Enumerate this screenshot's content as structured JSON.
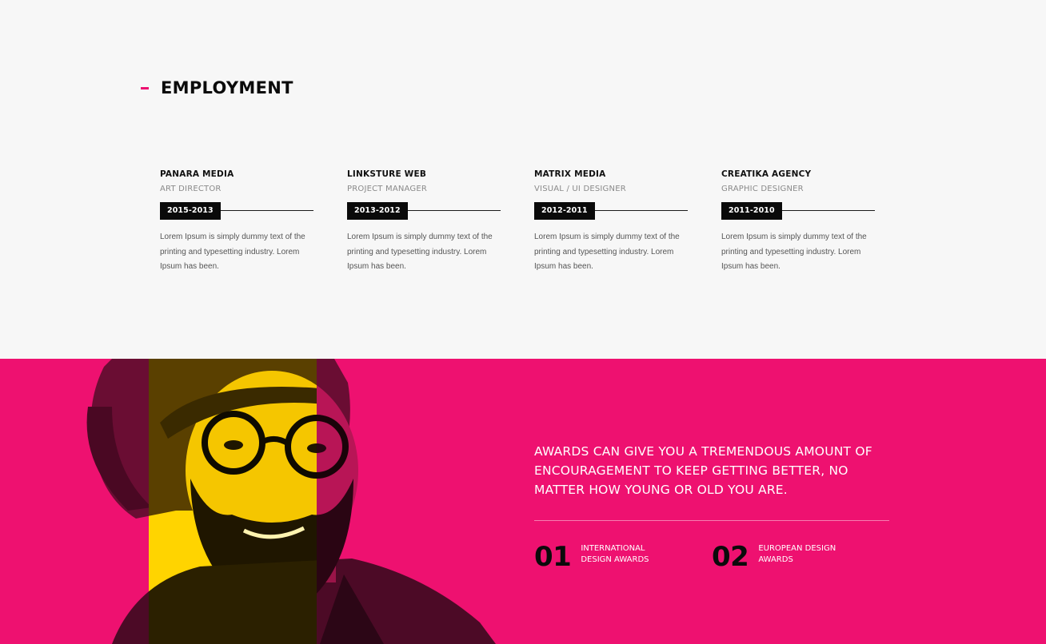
{
  "employment": {
    "title": "EMPLOYMENT",
    "jobs": [
      {
        "company": "PANARA MEDIA",
        "role": "ART DIRECTOR",
        "period": "2015-2013",
        "description": "Lorem Ipsum is simply dummy text of the printing and typesetting industry. Lorem Ipsum has been."
      },
      {
        "company": "LINKSTURE WEB",
        "role": "PROJECT MANAGER",
        "period": "2013-2012",
        "description": "Lorem Ipsum is simply dummy text of the printing and typesetting industry. Lorem Ipsum has been."
      },
      {
        "company": "MATRIX MEDIA",
        "role": "VISUAL / UI DESIGNER",
        "period": "2012-2011",
        "description": "Lorem Ipsum is simply dummy text of the printing and typesetting industry. Lorem Ipsum has been."
      },
      {
        "company": "CREATIKA AGENCY",
        "role": "GRAPHIC DESIGNER",
        "period": "2011-2010",
        "description": "Lorem Ipsum is simply dummy text of the printing and typesetting industry. Lorem Ipsum has been."
      }
    ]
  },
  "awards": {
    "quote": "AWARDS CAN GIVE YOU A TREMENDOUS AMOUNT OF ENCOURAGEMENT TO KEEP GETTING BETTER, NO MATTER HOW YOUNG OR OLD YOU ARE.",
    "items": [
      {
        "number": "01",
        "label": "INTERNATIONAL DESIGN AWARDS"
      },
      {
        "number": "02",
        "label": "EUROPEAN DESIGN AWARDS"
      }
    ]
  },
  "colors": {
    "accent": "#ee1170",
    "highlight": "#ffd400",
    "background": "#f7f7f7",
    "dark": "#0a0a0a"
  }
}
